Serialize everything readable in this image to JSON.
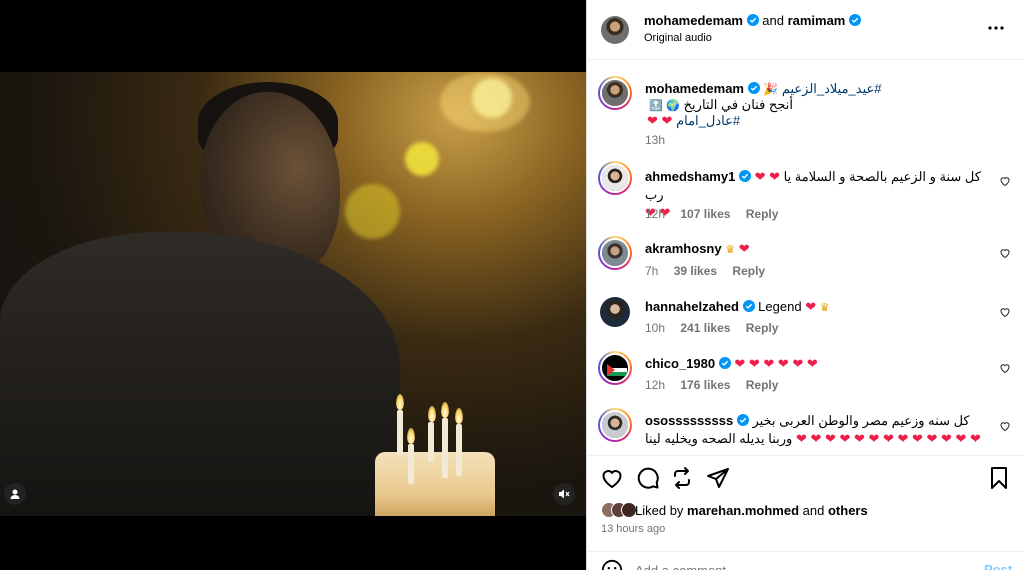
{
  "header": {
    "username": "mohamedemam",
    "joiner": "and",
    "collaborator": "ramimam",
    "audio": "Original audio",
    "more_icon": "more-horizontal-icon"
  },
  "caption": {
    "username": "mohamedemam",
    "hashtag1": "#عيد_ميلاد_الزعيم",
    "line2": "أنجح فنان في التاريخ",
    "hashtag2": "#عادل_امام",
    "time": "13h"
  },
  "comments": [
    {
      "username": "ahmedshamy1",
      "text": "كل سنة و الزعيم بالصحة و السلامة يا رب",
      "time": "12h",
      "likes": "107 likes",
      "reply": "Reply"
    },
    {
      "username": "akramhosny",
      "text": "",
      "time": "7h",
      "likes": "39 likes",
      "reply": "Reply"
    },
    {
      "username": "hannahelzahed",
      "text": "Legend",
      "time": "10h",
      "likes": "241 likes",
      "reply": "Reply"
    },
    {
      "username": "chico_1980",
      "text": "",
      "time": "12h",
      "likes": "176 likes",
      "reply": "Reply"
    },
    {
      "username": "ososssssssss",
      "text": "كل سنه وزعيم مصر والوطن العربى بخير وربنا يديله الصحه ويخليه لينا",
      "time": "",
      "likes": "",
      "reply": ""
    }
  ],
  "actions": {
    "liked_by_prefix": "Liked by",
    "liked_by_user": "marehan.mohmed",
    "liked_by_and": "and",
    "liked_by_others": "others",
    "time_ago": "13 hours ago",
    "add_comment_placeholder": "Add a comment...",
    "post_label": "Post"
  },
  "colors": {
    "heart": "#ed1f4a",
    "verified": "#0095f6",
    "link": "#00376b",
    "muted": "#737373"
  }
}
